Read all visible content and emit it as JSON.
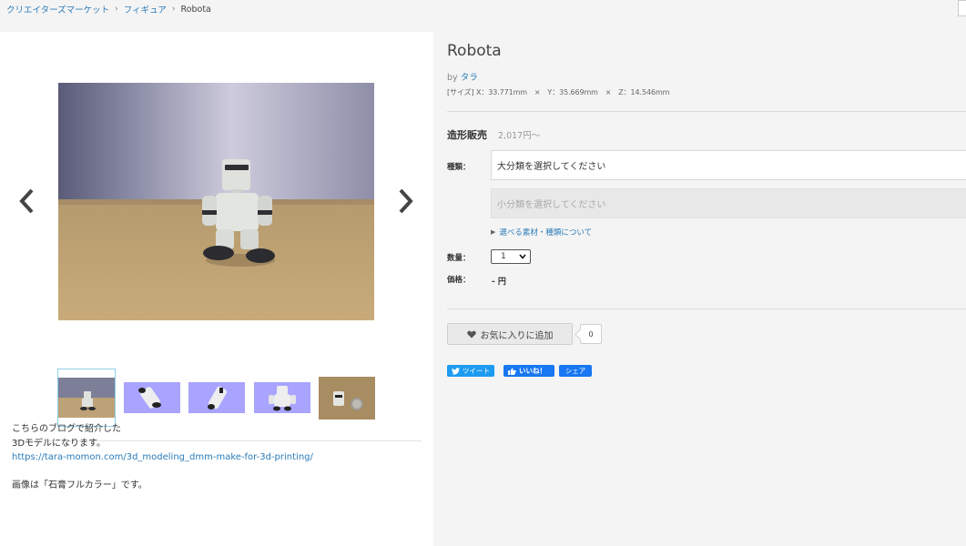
{
  "breadcrumb": {
    "items": [
      "クリエイターズマーケット",
      "フィギュア"
    ],
    "current": "Robota",
    "separator": "›"
  },
  "product": {
    "title": "Robota",
    "by_prefix": "by",
    "author": "タラ",
    "dimensions": "[サイズ] X：33.771mm　×　Y：35.669mm　×　Z：14.546mm"
  },
  "sale": {
    "title": "造形販売",
    "price_from": "2,017円〜",
    "type_label": "種類：",
    "major_placeholder": "大分類を選択してください",
    "minor_placeholder": "小分類を選択してください",
    "materials_link": "選べる素材・種類について",
    "quantity_label": "数量：",
    "quantity_value": "1",
    "price_label": "価格：",
    "price_value": "- 円"
  },
  "favorite": {
    "label": "お気に入りに追加",
    "count": "0"
  },
  "social": {
    "tweet": "ツイート",
    "like": "いいね！",
    "share": "シェア"
  },
  "description": {
    "line1": "こちらのブログで紹介した",
    "line2": "3Dモデルになります。",
    "link": "https://tara-momon.com/3d_modeling_dmm-make-for-3d-printing/",
    "line4": "画像は「石膏フルカラー」です。"
  },
  "colors": {
    "link": "#2a7bb8",
    "thumb_bg": "#a9a4ff",
    "tweet": "#1d9bf0",
    "facebook": "#1877f2"
  }
}
